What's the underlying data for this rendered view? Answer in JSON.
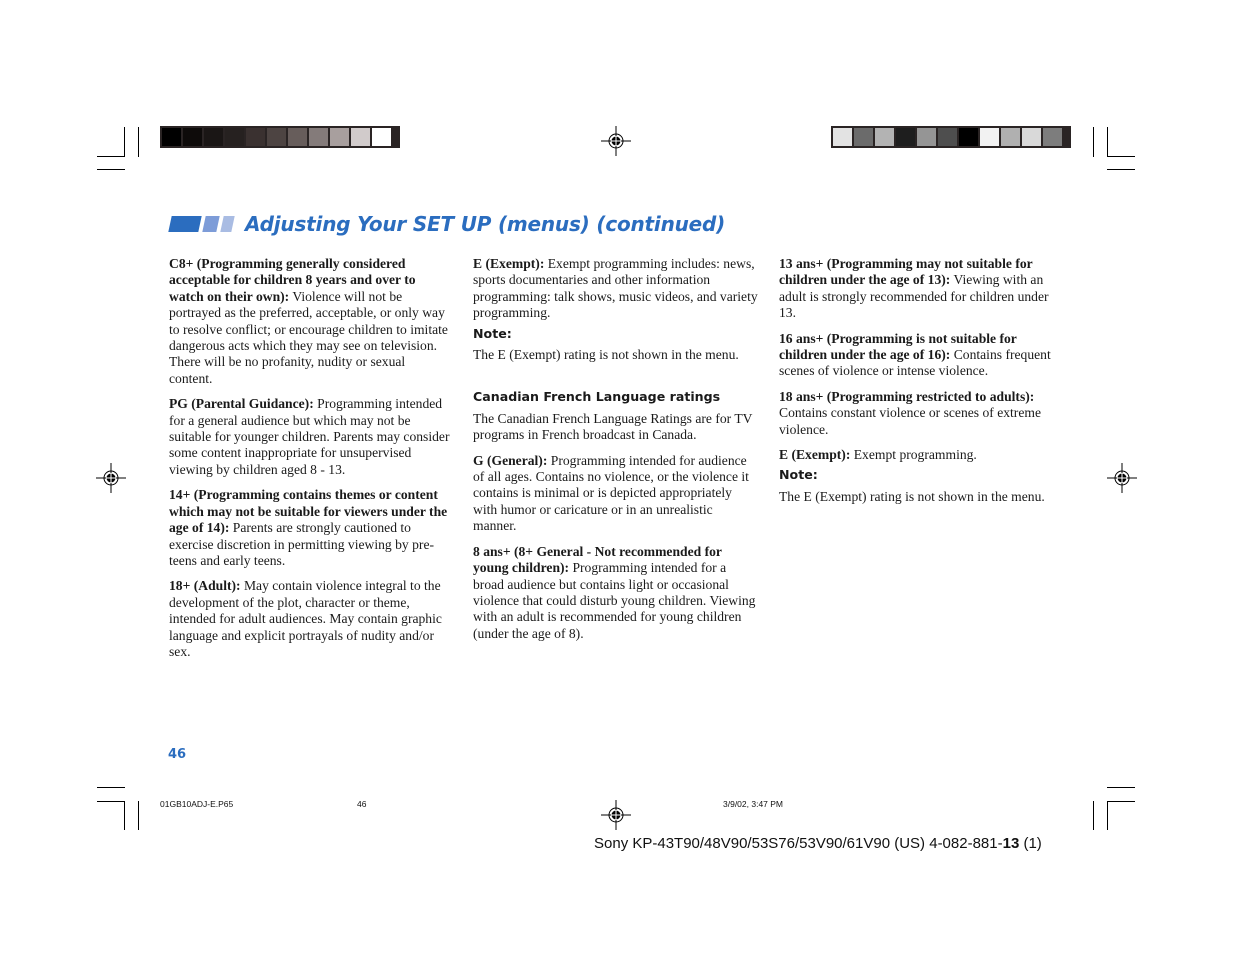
{
  "header": {
    "title": "Adjusting Your SET UP (menus) (continued)",
    "accent_color": "#2b6dbf"
  },
  "color_bars": {
    "left": [
      "#000000",
      "#0e0b0a",
      "#1a1615",
      "#262120",
      "#3a3130",
      "#4d4442",
      "#675d5b",
      "#847b7a",
      "#a89f9e",
      "#d1cbcb",
      "#ffffff"
    ],
    "right": [
      "#e3e3e3",
      "#6b6b6b",
      "#b3b3b3",
      "#1e1e1e",
      "#959595",
      "#4e4e4e",
      "#000000",
      "#f2f2f2",
      "#b0b0b0",
      "#d9d9d9",
      "#7d7d7d"
    ]
  },
  "columns": {
    "left": [
      {
        "term": "C8+ (Programming generally considered acceptable for children 8 years and over to watch on their own):",
        "desc": " Violence will not be portrayed as the preferred, acceptable, or only way to resolve conflict; or encourage children to imitate dangerous acts which they may see on television.  There will be no profanity, nudity or sexual content."
      },
      {
        "term": "PG (Parental Guidance):",
        "desc": "  Programming intended for a general audience but which may not be suitable for younger children. Parents may consider some content inappropriate for unsupervised viewing by children aged 8 - 13."
      },
      {
        "term": "14+ (Programming contains themes or content which may not be suitable for viewers under the age of 14):",
        "desc": "  Parents are strongly cautioned to exercise discretion in permitting viewing by pre-teens and early teens."
      },
      {
        "term": "18+ (Adult):",
        "desc": "  May contain violence integral to the development of the plot, character or theme, intended for adult audiences.  May contain graphic language and explicit portrayals of nudity and/or sex."
      }
    ],
    "middle": {
      "exempt": {
        "term": "E (Exempt):",
        "desc": "  Exempt programming includes: news, sports documentaries and other information programming:  talk shows, music videos, and variety programming."
      },
      "note_label": "Note:",
      "note_text": "The E (Exempt) rating is not shown in the menu.",
      "section_heading": "Canadian French Language ratings",
      "section_intro": "The Canadian French Language Ratings are for TV programs in French broadcast in Canada.",
      "items": [
        {
          "term": "G (General):",
          "desc": "  Programming intended for audience of all ages.  Contains no violence, or the violence it contains is minimal or is depicted appropriately with humor or caricature or in an unrealistic manner."
        },
        {
          "term": "8 ans+ (8+ General - Not recommended for young children):",
          "desc": "  Programming intended for a broad audience but contains light or occasional violence that could disturb young children. Viewing with an adult is recommended for young children (under the age of 8)."
        }
      ]
    },
    "right": {
      "items": [
        {
          "term": "13 ans+ (Programming may not suitable for children under the age of 13):",
          "desc": "  Viewing with an adult is strongly recommended for children under 13."
        },
        {
          "term": "16 ans+ (Programming is not suitable for children under the age of 16):",
          "desc": "  Contains frequent scenes of violence or intense violence."
        },
        {
          "term": "18 ans+ (Programming restricted to adults):",
          "desc": " Contains constant violence or scenes of extreme violence."
        },
        {
          "term": "E (Exempt):",
          "desc": "  Exempt programming."
        }
      ],
      "note_label": "Note:",
      "note_text": "The E (Exempt) rating is not shown in the menu."
    }
  },
  "page_number": "46",
  "slug": {
    "filename": "01GB10ADJ-E.P65",
    "page": "46",
    "datetime": "3/9/02, 3:47 PM"
  },
  "footer": {
    "prefix": "Sony KP-43T90/48V90/53S76/53V90/61V90 (US) 4-082-881-",
    "bold": "13",
    "suffix": " (1)"
  }
}
